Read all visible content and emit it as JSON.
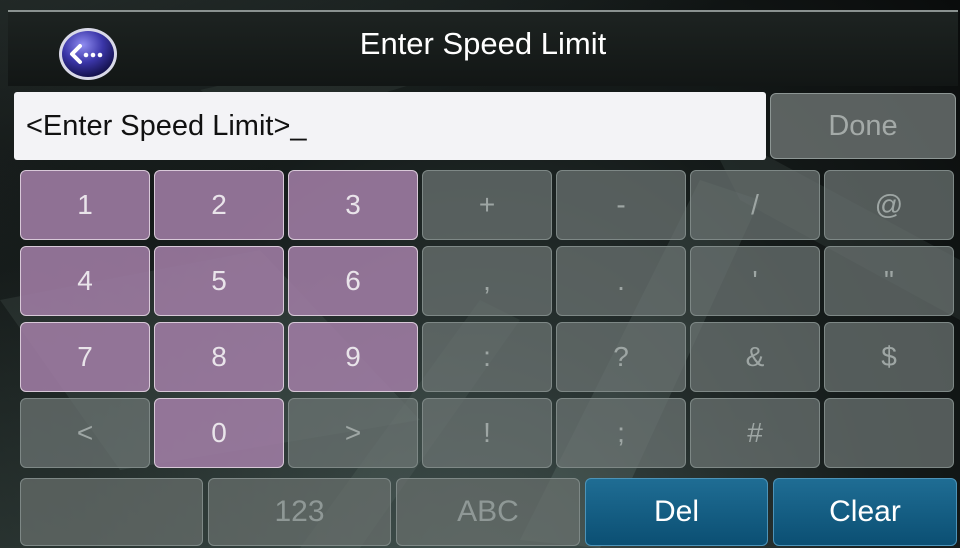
{
  "header": {
    "title": "Enter Speed Limit",
    "back_icon": "back-arrow-icon"
  },
  "input": {
    "value": "<Enter Speed Limit>_",
    "done_label": "Done"
  },
  "keypad": {
    "rows": [
      [
        {
          "label": "1",
          "type": "num"
        },
        {
          "label": "2",
          "type": "num"
        },
        {
          "label": "3",
          "type": "num"
        },
        {
          "label": "+",
          "type": "sym"
        },
        {
          "label": "-",
          "type": "sym"
        },
        {
          "label": "/",
          "type": "sym"
        },
        {
          "label": "@",
          "type": "sym"
        }
      ],
      [
        {
          "label": "4",
          "type": "num"
        },
        {
          "label": "5",
          "type": "num"
        },
        {
          "label": "6",
          "type": "num"
        },
        {
          "label": ",",
          "type": "sym"
        },
        {
          "label": ".",
          "type": "sym"
        },
        {
          "label": "'",
          "type": "sym"
        },
        {
          "label": "\"",
          "type": "sym"
        }
      ],
      [
        {
          "label": "7",
          "type": "num"
        },
        {
          "label": "8",
          "type": "num"
        },
        {
          "label": "9",
          "type": "num"
        },
        {
          "label": ":",
          "type": "sym"
        },
        {
          "label": "?",
          "type": "sym"
        },
        {
          "label": "&",
          "type": "sym"
        },
        {
          "label": "$",
          "type": "sym"
        }
      ],
      [
        {
          "label": "<",
          "type": "sym"
        },
        {
          "label": "0",
          "type": "num"
        },
        {
          "label": ">",
          "type": "sym"
        },
        {
          "label": "!",
          "type": "sym"
        },
        {
          "label": ";",
          "type": "sym"
        },
        {
          "label": "#",
          "type": "sym"
        },
        {
          "label": "",
          "type": "blank"
        }
      ]
    ]
  },
  "bottom_bar": {
    "keys": [
      {
        "label": "",
        "style": "gray",
        "name": "blank-mode-button"
      },
      {
        "label": "123",
        "style": "gray",
        "name": "numeric-mode-button"
      },
      {
        "label": "ABC",
        "style": "gray",
        "name": "alpha-mode-button"
      },
      {
        "label": "Del",
        "style": "blue",
        "name": "delete-button"
      },
      {
        "label": "Clear",
        "style": "blue",
        "name": "clear-button"
      }
    ]
  },
  "colors": {
    "number_key": "#a07da5",
    "action_key": "#0b4f73",
    "back_button": "#3b36a8"
  }
}
